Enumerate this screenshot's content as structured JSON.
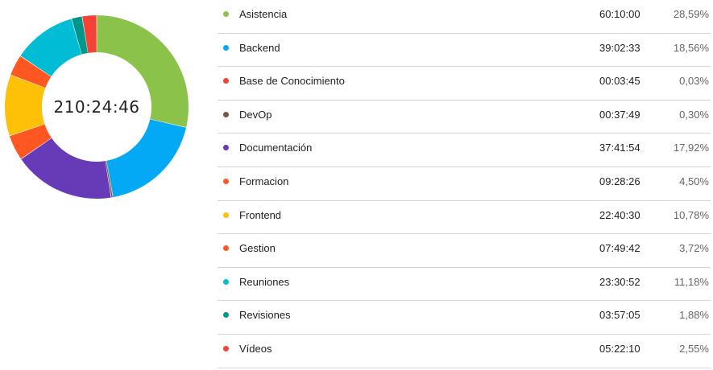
{
  "summary": {
    "total_time": "210:24:46"
  },
  "categories": [
    {
      "name": "Asistencia",
      "time": "60:10:00",
      "percent_label": "28,59%",
      "share": 28.59,
      "color": "#8bc34a"
    },
    {
      "name": "Backend",
      "time": "39:02:33",
      "percent_label": "18,56%",
      "share": 18.56,
      "color": "#03a9f4"
    },
    {
      "name": "Base de Conocimiento",
      "time": "00:03:45",
      "percent_label": "0,03%",
      "share": 0.03,
      "color": "#f44336"
    },
    {
      "name": "DevOp",
      "time": "00:37:49",
      "percent_label": "0,30%",
      "share": 0.3,
      "color": "#795548"
    },
    {
      "name": "Documentación",
      "time": "37:41:54",
      "percent_label": "17,92%",
      "share": 17.92,
      "color": "#673ab7"
    },
    {
      "name": "Formacion",
      "time": "09:28:26",
      "percent_label": "4,50%",
      "share": 4.5,
      "color": "#ff5722"
    },
    {
      "name": "Frontend",
      "time": "22:40:30",
      "percent_label": "10,78%",
      "share": 10.78,
      "color": "#ffc107"
    },
    {
      "name": "Gestion",
      "time": "07:49:42",
      "percent_label": "3,72%",
      "share": 3.72,
      "color": "#ff5722"
    },
    {
      "name": "Reuniones",
      "time": "23:30:52",
      "percent_label": "11,18%",
      "share": 11.18,
      "color": "#00bcd4"
    },
    {
      "name": "Revisiones",
      "time": "03:57:05",
      "percent_label": "1,88%",
      "share": 1.88,
      "color": "#009688"
    },
    {
      "name": "Vídeos",
      "time": "05:22:10",
      "percent_label": "2,55%",
      "share": 2.55,
      "color": "#f44336"
    }
  ]
}
